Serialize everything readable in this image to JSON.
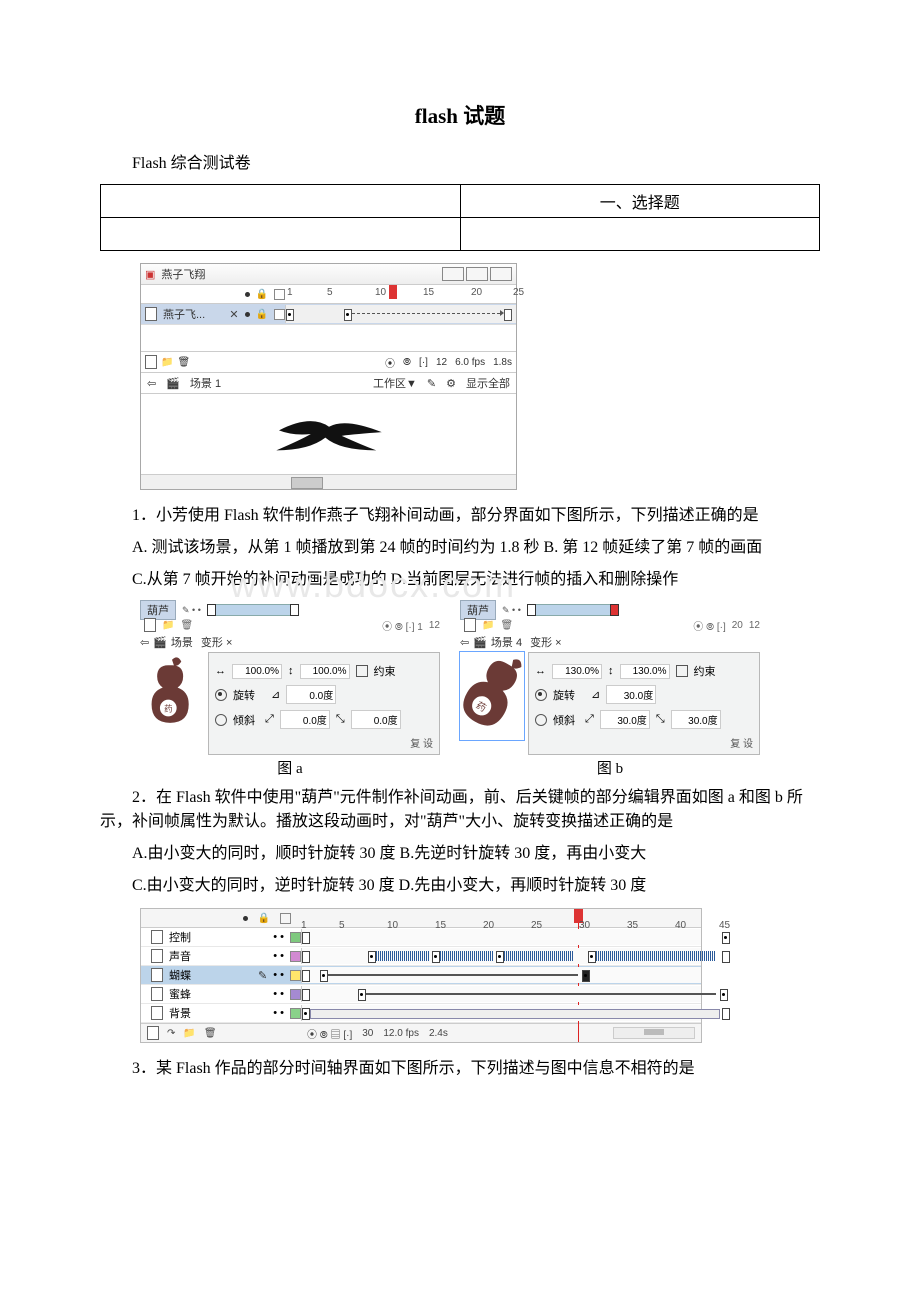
{
  "title": "flash 试题",
  "intro": "Flash 综合测试卷",
  "section_table": {
    "r1c1": "",
    "r1c2": "一、选择题",
    "r2c1": "",
    "r2c2": ""
  },
  "fig1": {
    "win_title": "燕子飞翔",
    "ruler": [
      "1",
      "5",
      "10",
      "15",
      "20",
      "25"
    ],
    "layer_name": "燕子飞...",
    "status_frame": "12",
    "status_fps": "6.0 fps",
    "status_time": "1.8s",
    "scene_label": "场景 1",
    "workarea": "工作区▼",
    "show_all": "显示全部"
  },
  "q1": {
    "stem": "1．小芳使用 Flash 软件制作燕子飞翔补间动画，部分界面如下图所示，下列描述正确的是",
    "optAB": "A. 测试该场景，从第 1 帧播放到第 24 帧的时间约为 1.8 秒 B. 第 12 帧延续了第 7 帧的画面",
    "optCD": "C.从第 7 帧开始的补间动画是成功的  D.当前图层无法进行帧的插入和删除操作"
  },
  "fig2": {
    "layer_label": "葫芦",
    "scene_a": "场景",
    "scene_b": "场景 4",
    "tab": "变形 ×",
    "scale_a_w": "100.0%",
    "scale_a_h": "100.0%",
    "scale_b_w": "130.0%",
    "scale_b_h": "130.0%",
    "constrain": "约束",
    "rotate": "旋转",
    "skew": "倾斜",
    "rot_a": "0.0度",
    "skew_a1": "0.0度",
    "skew_a2": "0.0度",
    "rot_b": "30.0度",
    "skew_b1": "30.0度",
    "skew_b2": "30.0度",
    "ruler_a_end": "12",
    "ruler_b_end": "12",
    "ruler_b_20": "20",
    "footer": "复 设",
    "label_a": "图 a",
    "label_b": "图 b"
  },
  "q2": {
    "stem": "2．在 Flash 软件中使用\"葫芦\"元件制作补间动画，前、后关键帧的部分编辑界面如图 a 和图 b 所示，补间帧属性为默认。播放这段动画时，对\"葫芦\"大小、旋转变换描述正确的是",
    "optAB": "A.由小变大的同时，顺时针旋转 30 度  B.先逆时针旋转 30 度，再由小变大",
    "optCD": "C.由小变大的同时，逆时针旋转 30 度  D.先由小变大，再顺时针旋转 30 度"
  },
  "fig3": {
    "ruler": [
      "1",
      "5",
      "10",
      "15",
      "20",
      "25",
      "30",
      "35",
      "40",
      "45"
    ],
    "layers": [
      "控制",
      "声音",
      "蝴蝶",
      "蜜蜂",
      "背景"
    ],
    "frame": "30",
    "fps": "12.0 fps",
    "time": "2.4s"
  },
  "q3": {
    "stem": "3．某 Flash 作品的部分时间轴界面如下图所示，下列描述与图中信息不相符的是"
  },
  "watermark": "www.bdocx.com"
}
